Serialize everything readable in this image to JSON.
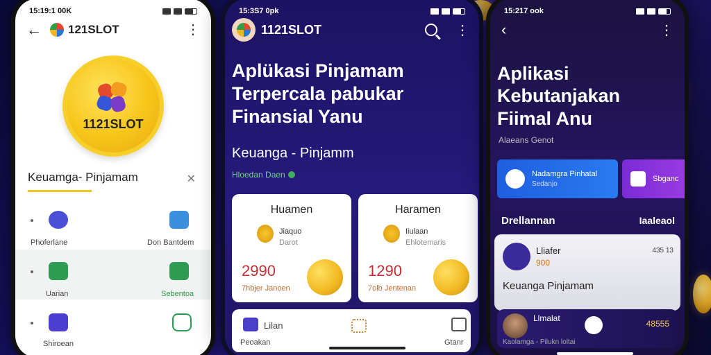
{
  "phone1": {
    "time": "15:19:1 00K",
    "brand": "121SLOT",
    "coin_label": "1121SLOT",
    "section_title": "Keuamga- Pinjamam",
    "rows": [
      {
        "left": "Phoferlane",
        "right": "Don Bantdem"
      },
      {
        "left": "Uarian",
        "right": "Sebentoa"
      },
      {
        "left": "Shiroean",
        "right": ""
      }
    ]
  },
  "phone2": {
    "time": "15:3S7 0pk",
    "brand": "1121SLOT",
    "hero": "Aplükasi Pinjamam Terpercala pabukar Finansial Yanu",
    "sub": "Keuanga - Pinjamm",
    "note": "Hloedan Daen",
    "cards": [
      {
        "title": "Huamen",
        "l1": "Jiaquo",
        "l2": "Darot",
        "amount": "2990",
        "caption": "7hbjer Janoen"
      },
      {
        "title": "Haramen",
        "l1": "Iiulaan",
        "l2": "Ehlotemaris",
        "amount": "1290",
        "caption": "7olb Jentenan"
      }
    ],
    "nav": {
      "item1_top": "Lilan",
      "item1_bottom": "Peoakan",
      "item3": "Gtanr"
    }
  },
  "phone3": {
    "time": "15:217 ook",
    "hero": "Aplikasi Kebutanjakan Fiimal Anu",
    "note": "Alaeans Genot",
    "btn_blue_title": "Nadamgra Pinhatal",
    "btn_blue_sub": "Sedanjo",
    "btn_purple": "Sbganc",
    "section_left": "Drellannan",
    "section_right": "Iaaleaol",
    "panel": {
      "name": "Lliafer",
      "num": "900",
      "right": "435 13",
      "big": "Keuanga Pinjamam"
    },
    "bar": {
      "name": "Llmalat",
      "num": "48555",
      "foot": "Kaolamga - Pilukn loltai"
    }
  },
  "colors": {
    "accent": "#f2c414",
    "primary_bg": "#1d1263",
    "danger": "#c03035",
    "blue_btn": "#1e5fe0"
  }
}
